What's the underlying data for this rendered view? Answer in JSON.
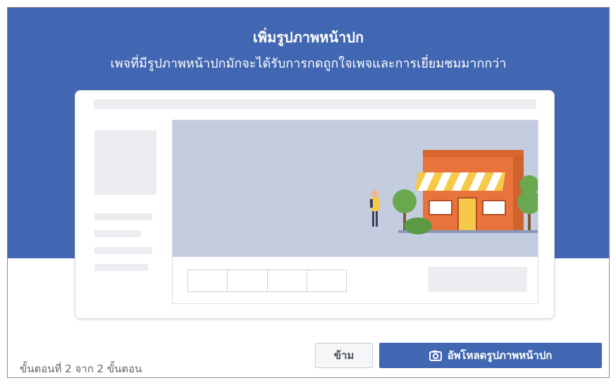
{
  "dialog": {
    "title": "เพิ่มรูปภาพหน้าปก",
    "subtitle": "เพจที่มีรูปภาพหน้าปกมักจะได้รับการกดถูกใจเพจและการเยี่ยมชมมากกว่า"
  },
  "illustration": {
    "icons": [
      "store-illustration",
      "person-illustration",
      "tree-illustration"
    ]
  },
  "footer": {
    "steps_text": "ขั้นตอนที่ 2 จาก 2 ขั้นตอน",
    "skip_label": "ข้าม",
    "upload_label": "อัพโหลดรูปภาพหน้าปก",
    "upload_icon": "camera-icon"
  },
  "colors": {
    "brand_blue": "#4267b2",
    "cover_bg": "#c4cce0",
    "placeholder_gray": "#ebedf0",
    "store_orange": "#e8743b",
    "awning_yellow": "#f7c948",
    "tree_green": "#6aa84f"
  }
}
